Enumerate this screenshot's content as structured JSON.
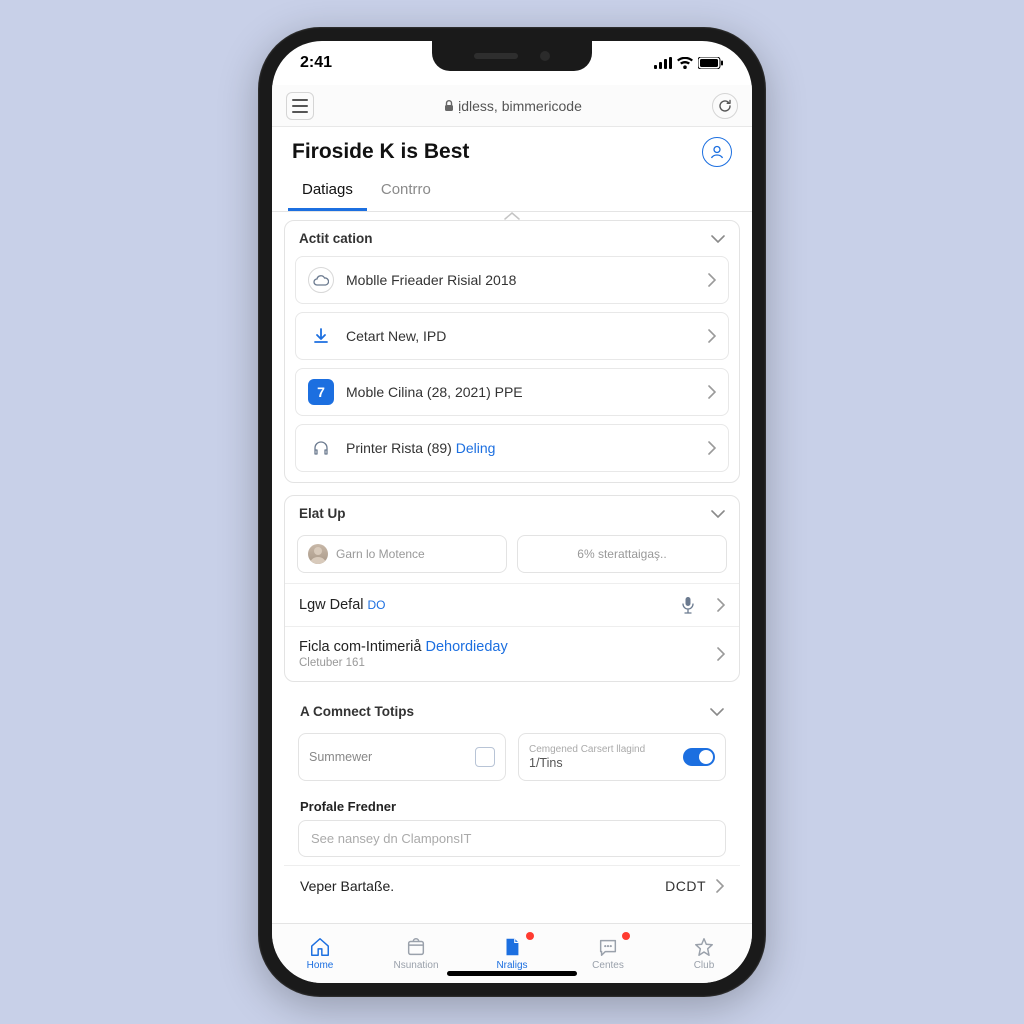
{
  "status": {
    "time": "2:41"
  },
  "browser": {
    "url": "ịdless, bimmericode"
  },
  "header": {
    "title": "Firoside K is Best"
  },
  "tabs": [
    {
      "label": "Datiags",
      "active": true
    },
    {
      "label": "Contrro",
      "active": false
    }
  ],
  "section1": {
    "title": "Actit cation",
    "items": [
      {
        "label": "Moblle Frieader Risial 2018",
        "icon": "cloud"
      },
      {
        "label": "Cetart New, IPD",
        "icon": "download"
      },
      {
        "label": "Moble Cilina (28, 2021) PPE",
        "icon": "num",
        "num": "7"
      },
      {
        "label_pre": "Printer Rista (89) ",
        "label_link": "Deling",
        "icon": "headset"
      }
    ]
  },
  "section2": {
    "title": "Elat Up",
    "chipA": "Garn lo Motence",
    "chipB": "6% sterattaigaş..",
    "rowA": {
      "text": "Lgw Defal",
      "badge": "DO"
    },
    "rowB": {
      "text_pre": "Ficla com-Intimeriå ",
      "text_link": "Dehordieday",
      "sub": "Cletuber 161"
    }
  },
  "section3": {
    "title": "A Comnect Totips",
    "cellA": "Summewer",
    "cellB_top": "Cemgened Carsert llagind",
    "cellB_bottom": "1/Tins"
  },
  "section4": {
    "title": "Profale Fredner",
    "placeholder": "See nansey dn ClamponsIT"
  },
  "rowFinal": {
    "text": "Veper Bartaße.",
    "value": "DCDT"
  },
  "tabbar": [
    {
      "label": "Home",
      "icon": "home",
      "active": true
    },
    {
      "label": "Nsunation",
      "icon": "box"
    },
    {
      "label": "Nraligs",
      "icon": "doc",
      "active": true,
      "badge": true
    },
    {
      "label": "Centes",
      "icon": "chat",
      "badge": true
    },
    {
      "label": "Club",
      "icon": "star"
    }
  ]
}
